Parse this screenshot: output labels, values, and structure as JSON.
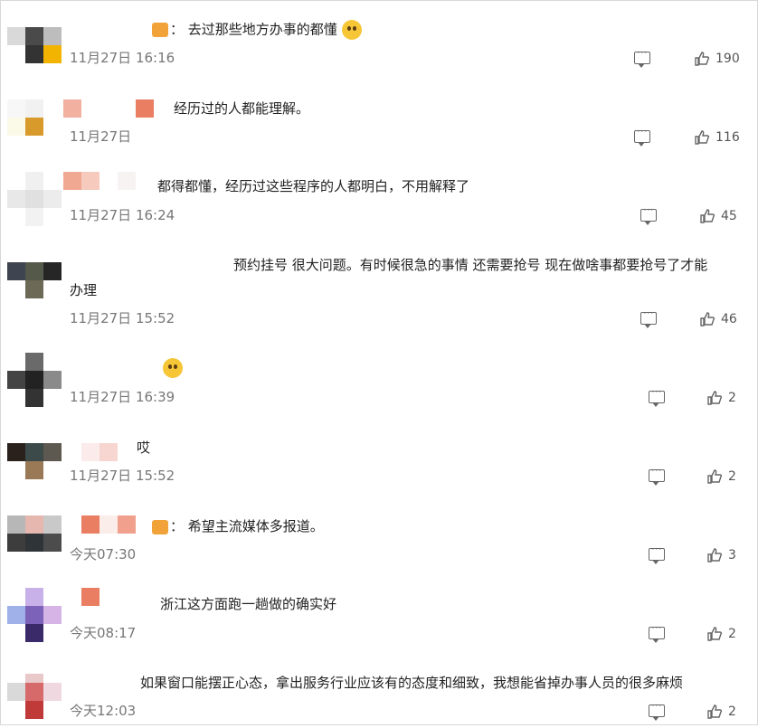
{
  "comments": [
    {
      "text": "：  去过那些地方办事的都懂",
      "time": "11月27日 16:16",
      "likes": "190",
      "has_crown": true,
      "has_emoji": true
    },
    {
      "text": "经历过的人都能理解。",
      "time": "11月27日",
      "likes": "116"
    },
    {
      "text": "都得都懂，经历过这些程序的人都明白，不用解释了",
      "time": "11月27日 16:24",
      "likes": "45"
    },
    {
      "text": "预约挂号 很大问题。有时候很急的事情 还需要抢号 现在做啥事都要抢号了才能",
      "text_line2": "办理",
      "time": "11月27日 15:52",
      "likes": "46"
    },
    {
      "text": "",
      "time": "11月27日 16:39",
      "likes": "2",
      "has_emoji": true
    },
    {
      "text": "哎",
      "time": "11月27日 15:52",
      "likes": "2"
    },
    {
      "text": "：  希望主流媒体多报道。",
      "time": "今天07:30",
      "likes": "3",
      "has_crown": true
    },
    {
      "text": "浙江这方面跑一趟做的确实好",
      "time": "今天08:17",
      "likes": "2"
    },
    {
      "text": "如果窗口能摆正心态，拿出服务行业应该有的态度和细致，我想能省掉办事人员的很多麻烦",
      "time": "今天12:03",
      "likes": "2"
    }
  ],
  "colors": {
    "text": "#222222",
    "meta": "#777777",
    "icon": "#666666"
  }
}
